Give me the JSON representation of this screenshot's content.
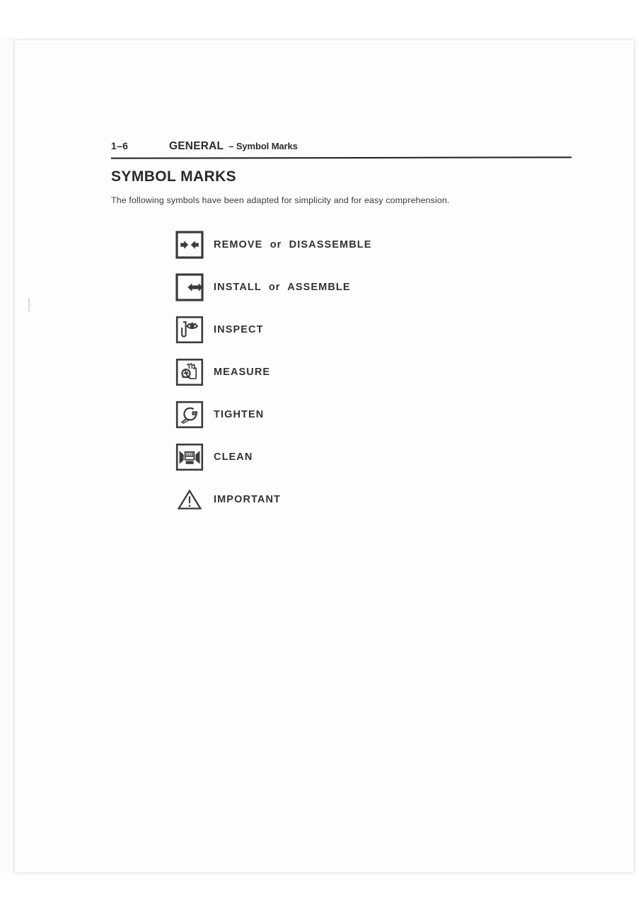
{
  "document": {
    "header": {
      "page_number": "1–6",
      "section": "GENERAL",
      "subsection": "– Symbol Marks"
    },
    "title": "SYMBOL MARKS",
    "intro": "The following symbols have been adapted for simplicity and for easy comprehension.",
    "symbols": [
      {
        "icon": "double-arrow-outward-icon",
        "label": "REMOVE  or  DISASSEMBLE"
      },
      {
        "icon": "double-arrow-inward-icon",
        "label": "INSTALL  or  ASSEMBLE"
      },
      {
        "icon": "eye-inspect-icon",
        "label": "INSPECT"
      },
      {
        "icon": "hand-gauge-measure-icon",
        "label": "MEASURE"
      },
      {
        "icon": "wrench-tighten-icon",
        "label": "TIGHTEN"
      },
      {
        "icon": "brush-clean-icon",
        "label": "CLEAN"
      },
      {
        "icon": "warning-triangle-icon",
        "label": "IMPORTANT"
      }
    ]
  },
  "colors": {
    "ink": "#333333",
    "rule": "#1d1d1d",
    "paper": "#fdfdfd",
    "backdrop": "#ffffff"
  }
}
